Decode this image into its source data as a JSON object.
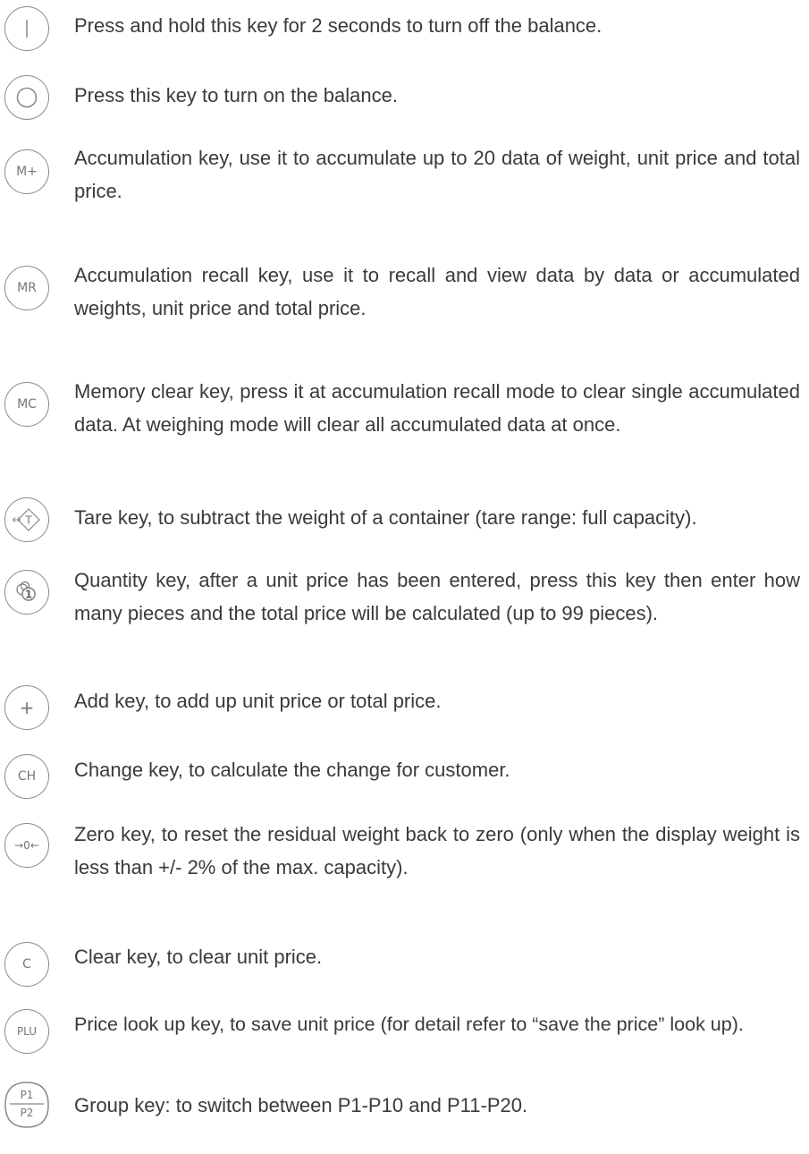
{
  "keys": [
    {
      "symbol": "|",
      "icon": "power-off-key-icon",
      "text": "Press and hold this key for 2 seconds to turn off the balance."
    },
    {
      "symbol": "O",
      "icon": "power-on-key-icon",
      "text": "Press this key to turn on the balance."
    },
    {
      "symbol": "M+",
      "icon": "accumulation-key-icon",
      "text": "Accumulation key, use it to accumulate up to 20 data of weight, unit price and total price."
    },
    {
      "symbol": "MR",
      "icon": "accumulation-recall-key-icon",
      "text": "Accumulation recall key, use it to recall and view data by data or accumulated weights, unit price and total price."
    },
    {
      "symbol": "MC",
      "icon": "memory-clear-key-icon",
      "text": "Memory clear key, press it at accumulation recall mode to clear single accumulated data. At weighing mode will clear all accumulated data at once."
    },
    {
      "symbol": "T",
      "icon": "tare-key-icon",
      "text": "Tare key, to subtract the weight of a container (tare range: full capacity)."
    },
    {
      "symbol": "1",
      "icon": "quantity-key-icon",
      "text": "Quantity key, after a unit price has been entered, press this key then enter how many pieces and the total price will be calculated (up to 99 pieces)."
    },
    {
      "symbol": "+",
      "icon": "add-key-icon",
      "text": "Add key, to add up unit price or total price."
    },
    {
      "symbol": "CH",
      "icon": "change-key-icon",
      "text": "Change key, to calculate the change for customer."
    },
    {
      "symbol": "→0←",
      "icon": "zero-key-icon",
      "text": "Zero key, to reset the residual weight back to zero (only when the display weight is less than +/- 2% of the max. capacity)."
    },
    {
      "symbol": "C",
      "icon": "clear-key-icon",
      "text": "Clear key, to clear unit price."
    },
    {
      "symbol": "PLU",
      "icon": "price-look-up-key-icon",
      "text": "Price look up key, to save unit price (for detail refer to “save the price” look up)."
    },
    {
      "symbol_top": "P1",
      "symbol_bottom": "P2",
      "icon": "group-key-icon",
      "text": "Group key: to switch between P1-P10 and P11-P20."
    }
  ]
}
